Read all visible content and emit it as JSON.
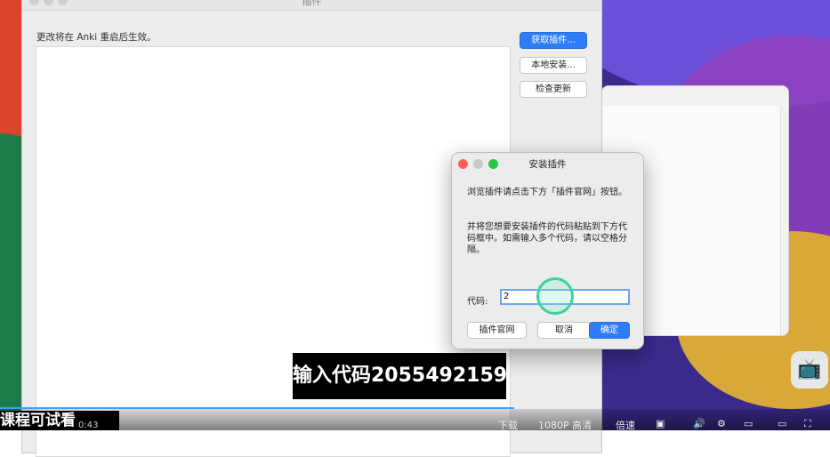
{
  "main_window": {
    "title": "插件",
    "notice": "更改将在 Anki 重启后生效。",
    "buttons": {
      "get": "获取插件...",
      "local": "本地安装...",
      "check": "检查更新"
    }
  },
  "dialog": {
    "title": "安装插件",
    "para1": "浏览插件请点击下方「插件官网」按钮。",
    "para2": "并将您想要安装插件的代码粘贴到下方代码框中。如需输入多个代码，请以空格分隔。",
    "code_label": "代码:",
    "code_value": "2",
    "buttons": {
      "website": "插件官网",
      "cancel": "取消",
      "ok": "确定"
    }
  },
  "video": {
    "caption": "输入代码2055492159",
    "subtitle_left": "课程可试看",
    "time": "0:43",
    "controls": [
      "下载",
      "1080P 高清",
      "倍速"
    ]
  }
}
